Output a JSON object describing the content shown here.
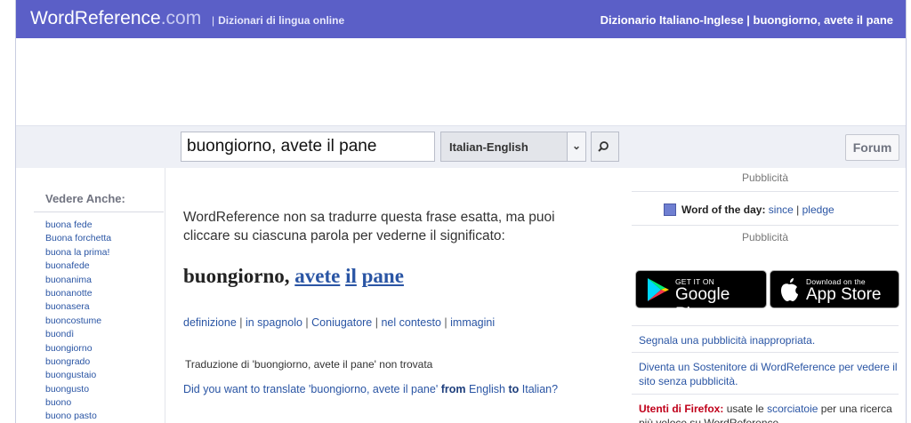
{
  "header": {
    "logo_main": "WordReference",
    "logo_suffix": ".com",
    "separator": "|",
    "tagline": "Dizionari di lingua online",
    "breadcrumb": "Dizionario Italiano-Inglese | buongiorno, avete il pane"
  },
  "search": {
    "query": "buongiorno, avete il pane",
    "dictionary": "Italian-English",
    "search_icon": "magnifier-icon",
    "forum_label": "Forum"
  },
  "sidebar": {
    "title": "Vedere Anche:",
    "items": [
      "buona fede",
      "Buona forchetta",
      "buona la prima!",
      "buonafede",
      "buonanima",
      "buonanotte",
      "buonasera",
      "buoncostume",
      "buondì",
      "buongiorno",
      "buongrado",
      "buongustaio",
      "buongusto",
      "buono",
      "buono pasto"
    ]
  },
  "main": {
    "message": "WordReference non sa tradurre questa frase esatta, ma puoi cliccare su ciascuna parola per vederne il significato:",
    "phrase": {
      "first": "buongiorno,",
      "words": [
        "avete",
        "il",
        "pane"
      ]
    },
    "tools": [
      "definizione",
      "in spagnolo",
      "Coniugatore",
      "nel contesto",
      "immagini"
    ],
    "tools_separator": "|",
    "not_found": "Traduzione di 'buongiorno, avete il pane' non trovata",
    "did_you_mean": {
      "prefix": "Did you want to translate 'buongiorno, avete il pane'",
      "from_word": "from",
      "lang_from": "English",
      "to_word": "to",
      "lang_to": "Italian?"
    }
  },
  "right": {
    "ad_label_1": "Pubblicità",
    "wotd_label": "Word of the day:",
    "wotd_words": [
      "since",
      "pledge"
    ],
    "wotd_separator": "|",
    "ad_label_2": "Pubblicità",
    "google_play": {
      "small": "GET IT ON",
      "big": "Google Play"
    },
    "app_store": {
      "small": "Download on the",
      "big": "App Store"
    },
    "report_ad": "Segnala una pubblicità inappropriata.",
    "supporter": "Diventa un Sostenitore di WordReference per vedere il sito senza pubblicità.",
    "firefox": {
      "label": "Utenti di Firefox:",
      "text_before": "usate le",
      "link": "scorciatoie",
      "text_after": "per una ricerca più veloce su WordReference."
    }
  },
  "colors": {
    "header_bg": "#5b5fc7",
    "link": "#2a55a4",
    "search_bar_bg": "#eef0f6",
    "firefox_label": "#c0001a"
  }
}
